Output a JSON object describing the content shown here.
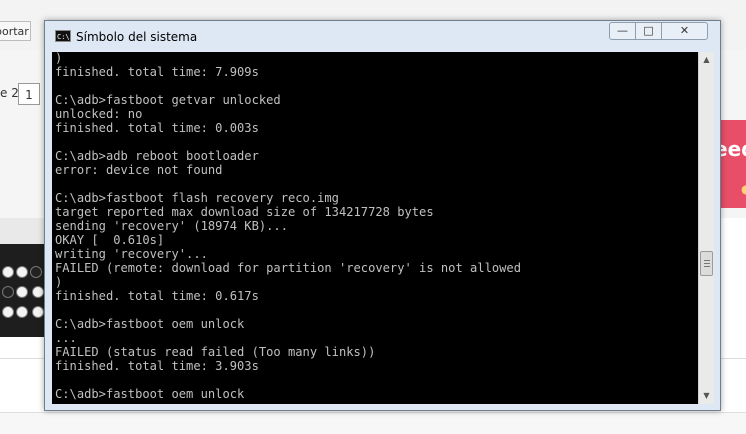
{
  "background": {
    "export_button": "portar",
    "page_prefix": "e 2",
    "page_number": "1",
    "ad_text": "eed",
    "ad_dot": "●"
  },
  "window": {
    "title": "Símbolo del sistema",
    "icon_label": "C:\\",
    "buttons": {
      "minimize": "—",
      "maximize": "□",
      "close": "✕"
    }
  },
  "console": {
    "lines": [
      ")",
      "finished. total time: 7.909s",
      "",
      "C:\\adb>fastboot getvar unlocked",
      "unlocked: no",
      "finished. total time: 0.003s",
      "",
      "C:\\adb>adb reboot bootloader",
      "error: device not found",
      "",
      "C:\\adb>fastboot flash recovery reco.img",
      "target reported max download size of 134217728 bytes",
      "sending 'recovery' (18974 KB)...",
      "OKAY [  0.610s]",
      "writing 'recovery'...",
      "FAILED (remote: download for partition 'recovery' is not allowed",
      ")",
      "finished. total time: 0.617s",
      "",
      "C:\\adb>fastboot oem unlock",
      "...",
      "FAILED (status read failed (Too many links))",
      "finished. total time: 3.903s",
      "",
      "C:\\adb>fastboot oem unlock"
    ]
  },
  "scrollbar": {
    "up_arrow": "▲",
    "down_arrow": "▼",
    "position": 0.62
  },
  "colors": {
    "console_bg": "#000000",
    "console_fg": "#c0c0c0",
    "window_frame": "#dde8f4",
    "ad_bg": "#e84e68"
  }
}
